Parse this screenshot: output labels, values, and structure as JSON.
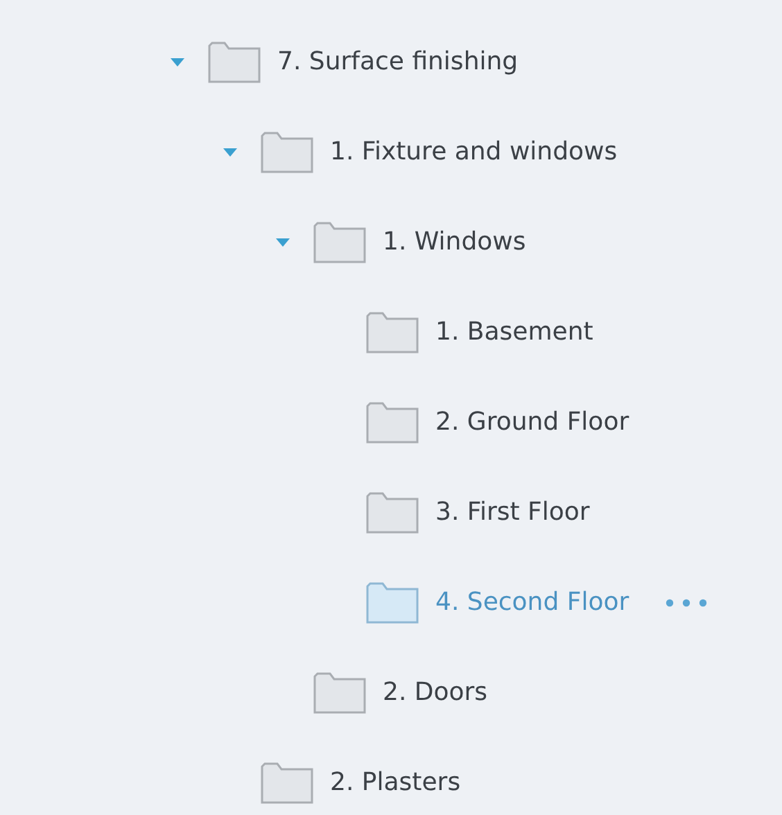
{
  "tree": [
    {
      "label": "7. Surface finishing",
      "expanded": true,
      "selected": false,
      "children": [
        {
          "label": "1. Fixture and windows",
          "expanded": true,
          "selected": false,
          "children": [
            {
              "label": "1. Windows",
              "expanded": true,
              "selected": false,
              "children": [
                {
                  "label": "1. Basement",
                  "expanded": false,
                  "selected": false
                },
                {
                  "label": "2. Ground Floor",
                  "expanded": false,
                  "selected": false
                },
                {
                  "label": "3. First Floor",
                  "expanded": false,
                  "selected": false
                },
                {
                  "label": "4. Second Floor",
                  "expanded": false,
                  "selected": true
                }
              ]
            },
            {
              "label": "2. Doors",
              "expanded": false,
              "selected": false
            }
          ]
        },
        {
          "label": "2. Plasters",
          "expanded": false,
          "selected": false
        }
      ]
    }
  ]
}
